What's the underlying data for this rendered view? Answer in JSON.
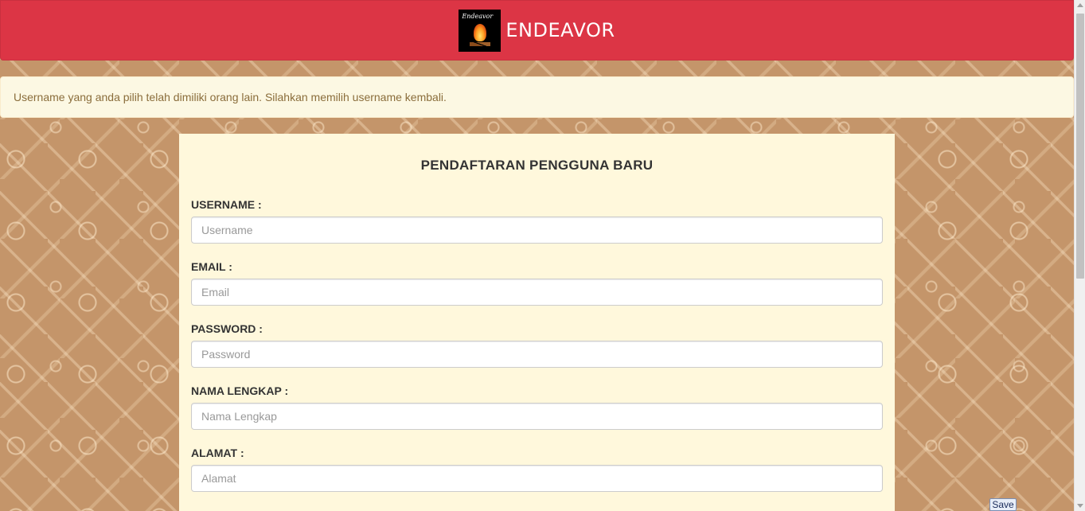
{
  "navbar": {
    "brand_text": "ENDEAVOR",
    "logo_script": "Endeavor",
    "background_color": "#dc3545"
  },
  "alert": {
    "message": "Username yang anda pilih telah dimiliki orang lain. Silahkan memilih username kembali."
  },
  "form": {
    "title": "PENDAFTARAN PENGGUNA BARU",
    "fields": [
      {
        "label": "USERNAME :",
        "placeholder": "Username",
        "value": ""
      },
      {
        "label": "EMAIL :",
        "placeholder": "Email",
        "value": ""
      },
      {
        "label": "PASSWORD :",
        "placeholder": "Password",
        "value": ""
      },
      {
        "label": "NAMA LENGKAP :",
        "placeholder": "Nama Lengkap",
        "value": ""
      },
      {
        "label": "ALAMAT :",
        "placeholder": "Alamat",
        "value": ""
      }
    ]
  },
  "overlay": {
    "save_label": "Save"
  }
}
